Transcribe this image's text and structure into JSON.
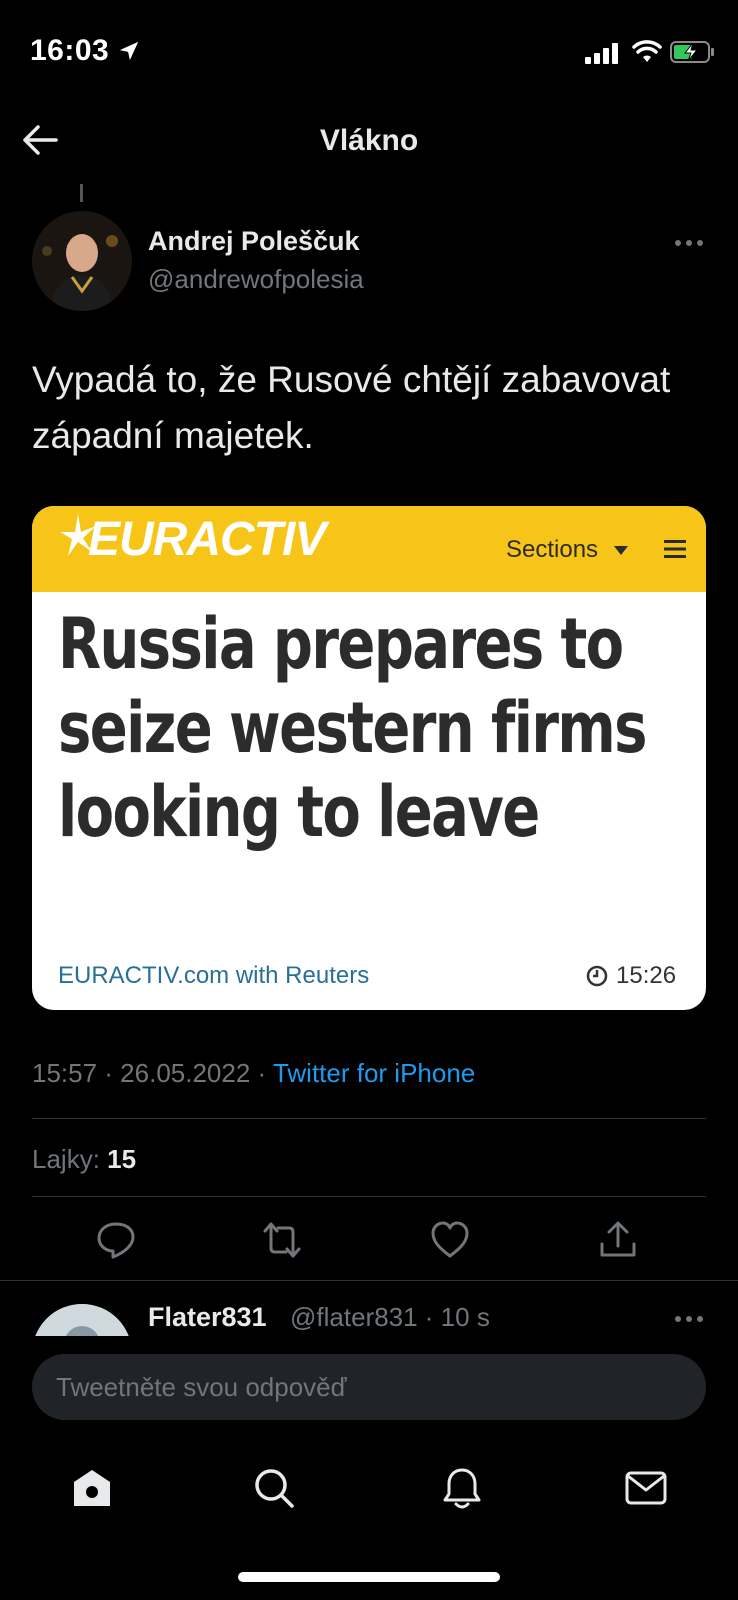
{
  "status_bar": {
    "time": "16:03"
  },
  "header": {
    "title": "Vlákno"
  },
  "tweet": {
    "author_name": "Andrej Poleščuk",
    "author_handle": "@andrewofpolesia",
    "text": "Vypadá to, že Rusové chtějí zabavovat západní majetek.",
    "timestamp": "15:57 · 26.05.2022 · ",
    "source": "Twitter for iPhone",
    "likes_label": "Lajky: ",
    "likes_count": "15"
  },
  "card": {
    "logo": "EURACTIV",
    "sections_label": "Sections",
    "headline": "Russia prepares to seize western firms looking to leave",
    "source": "EURACTIV.com with Reuters",
    "time": "15:26",
    "colors": {
      "band": "#f7c518",
      "link": "#2a6f97"
    }
  },
  "reply": {
    "author_name": "Flater831",
    "meta": "@flater831 · 10 s"
  },
  "compose": {
    "placeholder": "Tweetněte svou odpověď"
  },
  "icons": {
    "actions": [
      "reply-icon",
      "retweet-icon",
      "like-icon",
      "share-icon"
    ],
    "nav": [
      "home-icon",
      "search-icon",
      "notifications-icon",
      "messages-icon"
    ]
  },
  "colors": {
    "background": "#000000",
    "accent": "#1d9bf0",
    "secondary_text": "#71767b"
  }
}
